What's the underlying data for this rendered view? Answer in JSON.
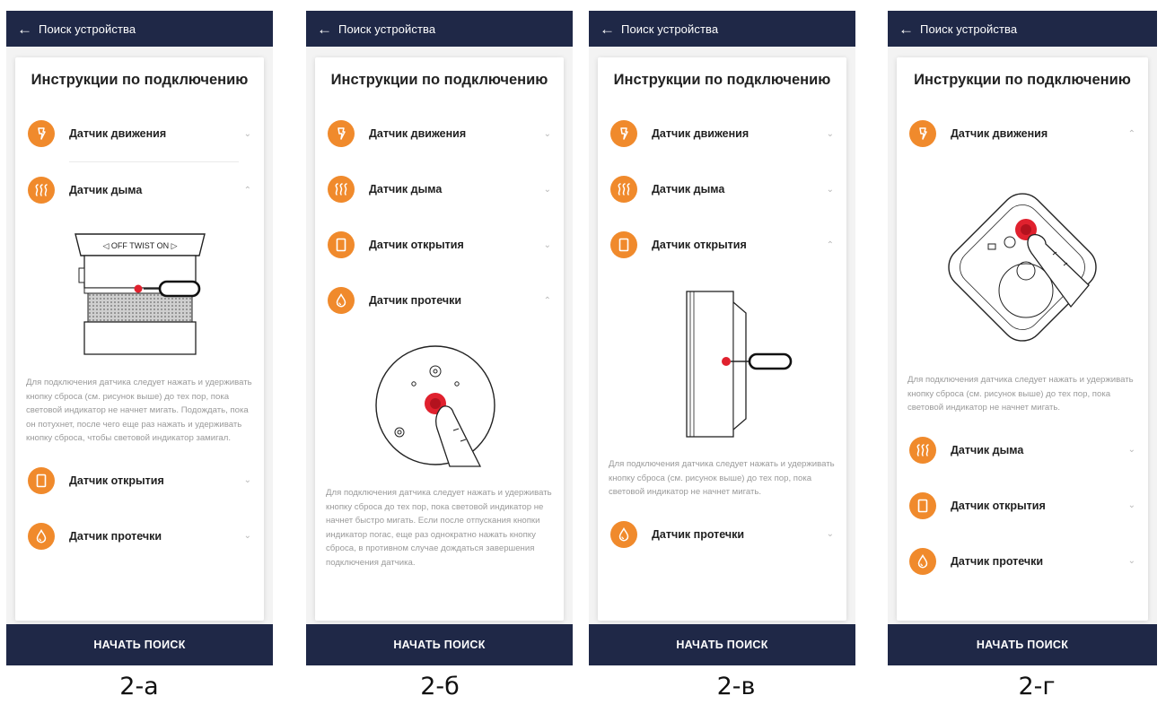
{
  "header_title": "Поиск устройства",
  "card_title": "Инструкции по подключению",
  "start_button": "НАЧАТЬ ПОИСК",
  "accent_color": "#f08a2c",
  "header_color": "#1f2847",
  "panels": [
    {
      "caption": "2-а",
      "items": [
        {
          "label": "Датчик движения",
          "icon": "motion-sensor-icon",
          "expanded": false
        },
        {
          "label": "Датчик дыма",
          "icon": "smoke-sensor-icon",
          "expanded": true,
          "illustration": "smoke",
          "text": "Для подключения датчика следует нажать и удерживать кнопку сброса (см. рисунок выше) до тех пор, пока световой индикатор не начнет мигать. Подождать, пока он потухнет, после чего еще раз нажать и удерживать кнопку сброса, чтобы световой индикатор замигал."
        },
        {
          "label": "Датчик открытия",
          "icon": "door-sensor-icon",
          "expanded": false
        },
        {
          "label": "Датчик протечки",
          "icon": "leak-sensor-icon",
          "expanded": false
        }
      ]
    },
    {
      "caption": "2-б",
      "items": [
        {
          "label": "Датчик движения",
          "icon": "motion-sensor-icon",
          "expanded": false
        },
        {
          "label": "Датчик дыма",
          "icon": "smoke-sensor-icon",
          "expanded": false
        },
        {
          "label": "Датчик открытия",
          "icon": "door-sensor-icon",
          "expanded": false
        },
        {
          "label": "Датчик протечки",
          "icon": "leak-sensor-icon",
          "expanded": true,
          "illustration": "leak",
          "text": "Для подключения датчика следует нажать и удерживать кнопку сброса до тех пор, пока световой индикатор не начнет быстро мигать. Если после отпускания кнопки индикатор погас, еще раз однократно нажать кнопку сброса, в противном случае дождаться завершения подключения датчика."
        }
      ]
    },
    {
      "caption": "2-в",
      "items": [
        {
          "label": "Датчик движения",
          "icon": "motion-sensor-icon",
          "expanded": false
        },
        {
          "label": "Датчик дыма",
          "icon": "smoke-sensor-icon",
          "expanded": false
        },
        {
          "label": "Датчик открытия",
          "icon": "door-sensor-icon",
          "expanded": true,
          "illustration": "door",
          "text": "Для подключения датчика следует нажать и удерживать кнопку сброса (см. рисунок выше) до тех пор, пока световой индикатор не начнет мигать."
        },
        {
          "label": "Датчик протечки",
          "icon": "leak-sensor-icon",
          "expanded": false
        }
      ]
    },
    {
      "caption": "2-г",
      "items": [
        {
          "label": "Датчик движения",
          "icon": "motion-sensor-icon",
          "expanded": true,
          "illustration": "motion",
          "text": "Для подключения датчика следует нажать и удерживать кнопку сброса (см. рисунок выше) до тех пор, пока световой индикатор не начнет мигать."
        },
        {
          "label": "Датчик дыма",
          "icon": "smoke-sensor-icon",
          "expanded": false
        },
        {
          "label": "Датчик открытия",
          "icon": "door-sensor-icon",
          "expanded": false
        },
        {
          "label": "Датчик протечки",
          "icon": "leak-sensor-icon",
          "expanded": false
        }
      ]
    }
  ]
}
